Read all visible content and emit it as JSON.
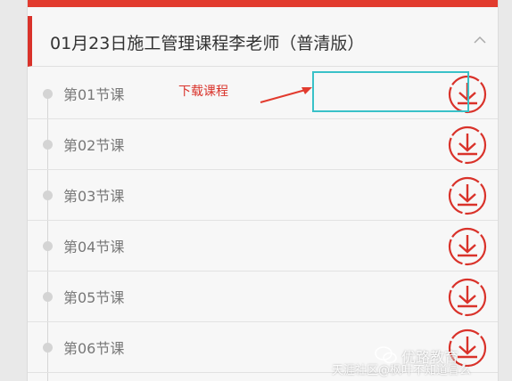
{
  "course": {
    "title": "01月23日施工管理课程李老师（普清版）"
  },
  "lessons": [
    {
      "label": "第01节课"
    },
    {
      "label": "第02节课"
    },
    {
      "label": "第03节课"
    },
    {
      "label": "第04节课"
    },
    {
      "label": "第05节课"
    },
    {
      "label": "第06节课"
    }
  ],
  "annotation": {
    "text": "下载课程"
  },
  "watermark": {
    "brand": "优路教育",
    "text": "天涯社区@枫叶不知道冒么"
  },
  "colors": {
    "accent": "#e23b2e",
    "highlight_box": "#39c1c8"
  }
}
